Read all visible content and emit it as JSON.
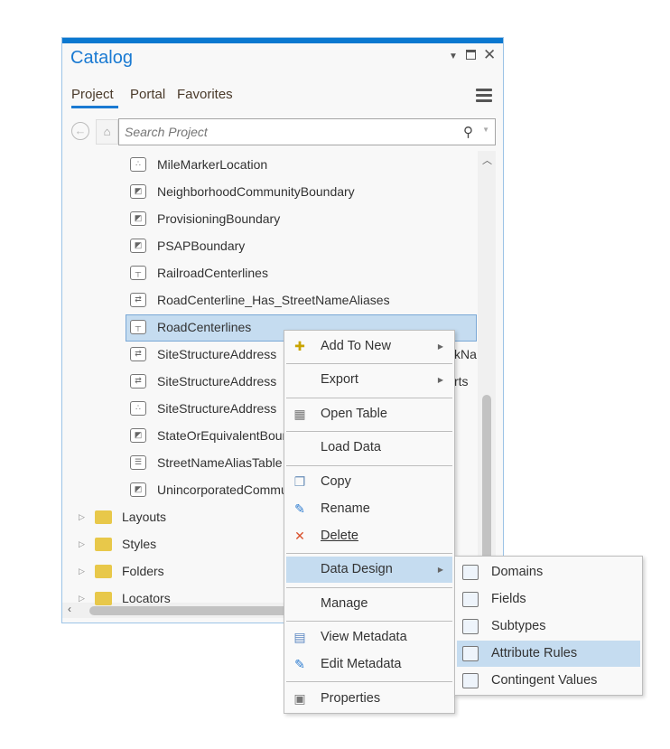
{
  "window": {
    "title": "Catalog",
    "pin_icon": "dropdown-arrow-icon",
    "maximize_icon": "maximize-icon",
    "close_icon": "close-icon"
  },
  "tabs": [
    {
      "label": "Project",
      "active": true
    },
    {
      "label": "Portal"
    },
    {
      "label": "Favorites"
    }
  ],
  "search": {
    "placeholder": "Search Project"
  },
  "tree": {
    "items": [
      {
        "label": "MileMarkerLocation",
        "icon": "point-feature-class-icon"
      },
      {
        "label": "NeighborhoodCommunityBoundary",
        "icon": "polygon-feature-class-icon"
      },
      {
        "label": "ProvisioningBoundary",
        "icon": "polygon-feature-class-icon"
      },
      {
        "label": "PSAPBoundary",
        "icon": "polygon-feature-class-icon"
      },
      {
        "label": "RailroadCenterlines",
        "icon": "line-feature-class-icon"
      },
      {
        "label": "RoadCenterline_Has_StreetNameAliases",
        "icon": "relationship-class-icon"
      },
      {
        "label": "RoadCenterlines",
        "icon": "line-feature-class-icon",
        "selected": true
      },
      {
        "label": "SiteStructureAddress",
        "icon": "relationship-class-icon",
        "tail": "kNa"
      },
      {
        "label": "SiteStructureAddress",
        "icon": "relationship-class-icon",
        "tail": "rts"
      },
      {
        "label": "SiteStructureAddress",
        "icon": "point-feature-class-icon"
      },
      {
        "label": "StateOrEquivalentBoundary",
        "icon": "polygon-feature-class-icon"
      },
      {
        "label": "StreetNameAliasTable",
        "icon": "table-icon"
      },
      {
        "label": "UnincorporatedCommunity",
        "icon": "polygon-feature-class-icon"
      }
    ],
    "folders": [
      {
        "label": "Layouts"
      },
      {
        "label": "Styles"
      },
      {
        "label": "Folders"
      },
      {
        "label": "Locators"
      }
    ]
  },
  "context_menu": {
    "items": [
      {
        "label": "Add To New",
        "submenu": true
      },
      {
        "label": "Export",
        "submenu": true
      },
      {
        "label": "Open Table"
      },
      {
        "label": "Load Data"
      },
      {
        "label": "Copy"
      },
      {
        "label": "Rename"
      },
      {
        "label": "Delete"
      },
      {
        "label": "Data Design",
        "submenu": true,
        "highlighted": true
      },
      {
        "label": "Manage"
      },
      {
        "label": "View Metadata"
      },
      {
        "label": "Edit Metadata"
      },
      {
        "label": "Properties"
      }
    ]
  },
  "submenu": {
    "items": [
      {
        "label": "Domains"
      },
      {
        "label": "Fields"
      },
      {
        "label": "Subtypes"
      },
      {
        "label": "Attribute Rules",
        "highlighted": true
      },
      {
        "label": "Contingent Values"
      }
    ]
  },
  "colors": {
    "accent": "#0a78d0",
    "highlight": "#c5dcf0"
  }
}
